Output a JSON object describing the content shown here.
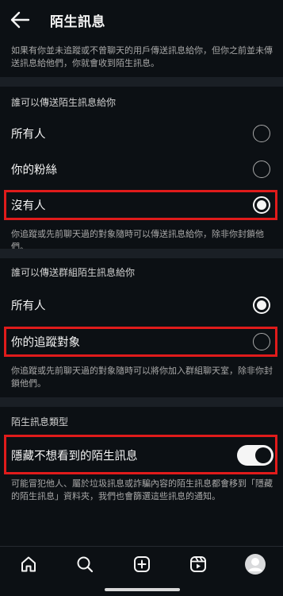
{
  "header": {
    "title": "陌生訊息",
    "back_icon": "arrow-left-icon"
  },
  "intro": {
    "text": "如果有你並未追蹤或不曾聊天的用戶傳送訊息給你，但你之前並未傳送訊息給他們，你就會收到陌生訊息。"
  },
  "direct_messages": {
    "heading": "誰可以傳送陌生訊息給你",
    "options": [
      {
        "label": "所有人",
        "selected": false
      },
      {
        "label": "你的粉絲",
        "selected": false
      },
      {
        "label": "沒有人",
        "selected": true
      }
    ],
    "note": "你追蹤或先前聊天過的對象隨時可以傳送訊息給你，除非你封鎖他們。"
  },
  "group_messages": {
    "heading": "誰可以傳送群組陌生訊息給你",
    "options": [
      {
        "label": "所有人",
        "selected": true
      },
      {
        "label": "你的追蹤對象",
        "selected": false
      }
    ],
    "note": "你追蹤或先前聊天過的對象隨時可以將你加入群組聊天室，除非你封鎖他們。"
  },
  "message_type": {
    "heading": "陌生訊息類型",
    "toggle_label": "隱藏不想看到的陌生訊息",
    "toggle_on": true,
    "note": "可能冒犯他人、屬於垃圾訊息或詐騙內容的陌生訊息都會移到「隱藏的陌生訊息」資料夾，我們也會篩選這些訊息的通知。"
  },
  "bottom_nav": {
    "icons": [
      "home-icon",
      "search-icon",
      "create-post-icon",
      "reels-icon",
      "profile-avatar-icon"
    ]
  },
  "colors": {
    "background": "#0c1014",
    "divider": "#1a1f25",
    "highlight": "#e01b1b",
    "text_secondary": "#a8a8a8"
  }
}
